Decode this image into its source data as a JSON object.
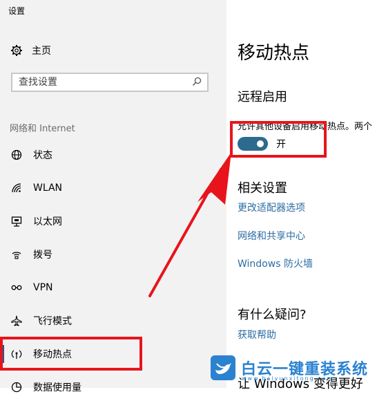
{
  "window": {
    "title": "设置"
  },
  "sidebar": {
    "home": {
      "label": "主页",
      "icon": "gear-icon"
    },
    "search": {
      "placeholder": "查找设置",
      "icon": "search-icon"
    },
    "section_label": "网络和 Internet",
    "items": [
      {
        "label": "状态",
        "icon": "globe-icon"
      },
      {
        "label": "WLAN",
        "icon": "wifi-icon"
      },
      {
        "label": "以太网",
        "icon": "ethernet-icon"
      },
      {
        "label": "拨号",
        "icon": "dialup-icon"
      },
      {
        "label": "VPN",
        "icon": "vpn-icon"
      },
      {
        "label": "飞行模式",
        "icon": "airplane-icon"
      },
      {
        "label": "移动热点",
        "icon": "hotspot-icon",
        "active": true
      },
      {
        "label": "数据使用量",
        "icon": "data-usage-icon"
      }
    ]
  },
  "main": {
    "title": "移动热点",
    "remote": {
      "heading": "远程启用",
      "description": "允许其他设备启用移动热点。两个",
      "toggle_state": "开",
      "toggle_on": true
    },
    "related": {
      "heading": "相关设置",
      "links": [
        "更改适配器选项",
        "网络和共享中心",
        "Windows 防火墙"
      ]
    },
    "questions": {
      "heading": "有什么疑问?",
      "link": "获取帮助"
    },
    "improve": {
      "heading": "让 Windows 变得更好"
    }
  },
  "watermark": {
    "text": "白云一键重装系统",
    "url": "www.baiyunxitong.com"
  },
  "colors": {
    "accent": "#2c6b8f",
    "link": "#2b6ca3",
    "annotation": "#e8141c",
    "sidebar_bg": "#f2f2f2"
  }
}
